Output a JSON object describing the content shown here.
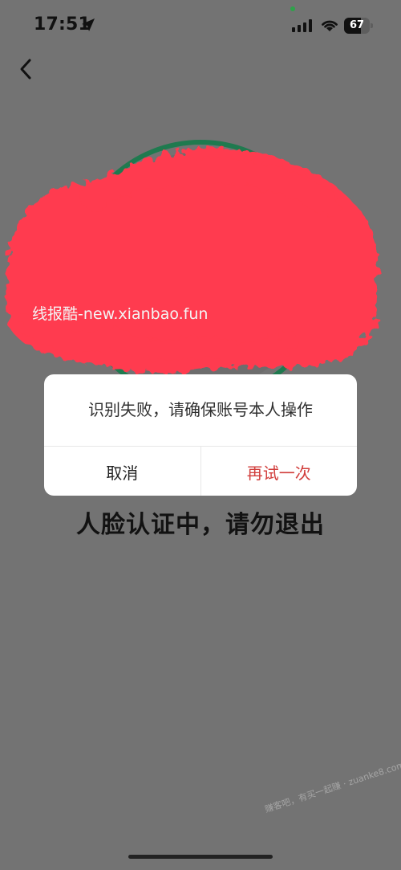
{
  "status_bar": {
    "time": "17:51",
    "battery_level": "67",
    "battery_fill_percent": 67,
    "icons": [
      "location-arrow-icon",
      "signal-icon",
      "wifi-icon",
      "battery-icon"
    ]
  },
  "navigation": {
    "back_icon": "chevron-left-icon"
  },
  "scan": {
    "watermark": "线报酷-new.xianbao.fun",
    "ring_color": "#1f7a4f",
    "redaction_color": "#ff3b4f"
  },
  "dialog": {
    "message": "识别失败，请确保账号本人操作",
    "cancel_label": "取消",
    "retry_label": "再试一次",
    "retry_color": "#d13d3b"
  },
  "main": {
    "status_text": "人脸认证中，请勿退出"
  },
  "footer": {
    "watermark": "赚客吧，有买一起赚 · zuanke8.com"
  }
}
